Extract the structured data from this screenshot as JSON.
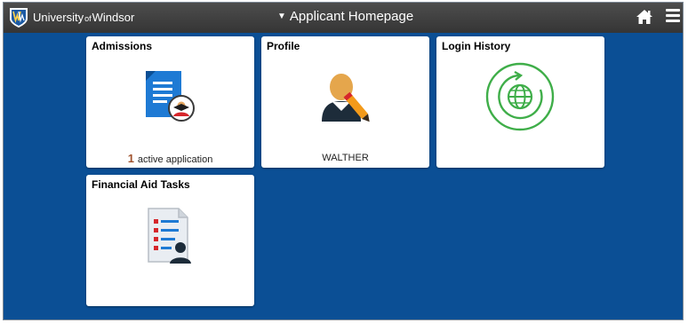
{
  "header": {
    "brand_main": "University",
    "brand_of": "of",
    "brand_end": "Windsor",
    "page_title": "Applicant Homepage"
  },
  "tiles": {
    "admissions": {
      "title": "Admissions",
      "count": "1",
      "footer": "active application"
    },
    "profile": {
      "title": "Profile",
      "footer": "WALTHER"
    },
    "login_history": {
      "title": "Login History"
    },
    "financial_aid": {
      "title": "Financial Aid Tasks"
    }
  },
  "colors": {
    "background": "#0b4f95",
    "header": "#3f3f3f",
    "login_history_icon": "#3fae49",
    "count_accent": "#a0522d"
  }
}
